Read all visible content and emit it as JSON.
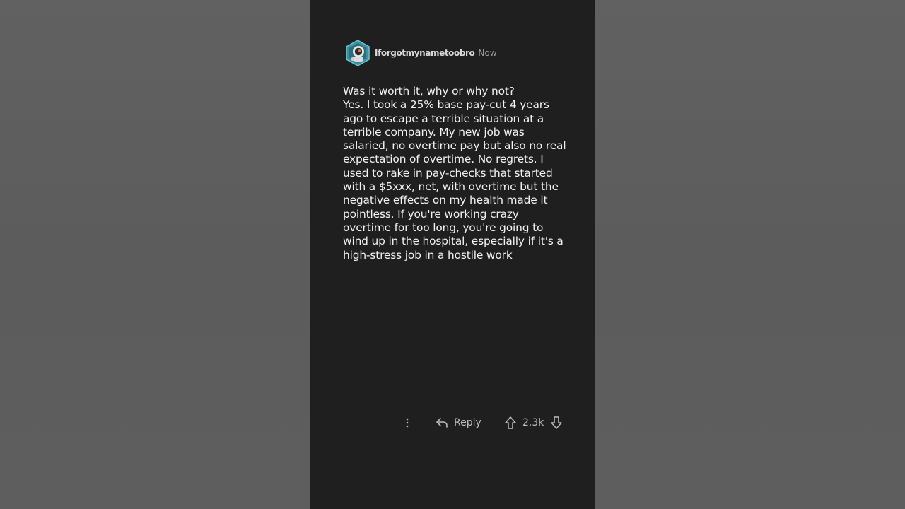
{
  "comment": {
    "username": "Iforgotmynametoobro",
    "timestamp": "Now",
    "body": "Was it worth it, why or why not?\nYes. I took a 25% base pay-cut 4 years ago to escape a terrible situation at a terrible company. My new job was salaried, no overtime pay but also no real expectation of overtime. No regrets. I used to rake in pay-checks that started with a $5xxx, net, with overtime but the negative effects on my health made it pointless. If you're working crazy overtime for too long, you're going to wind up in the hospital, especially if it's a high-stress job in a hostile work"
  },
  "actions": {
    "more_icon": "more-vertical-icon",
    "reply_icon": "reply-arrow-icon",
    "reply_label": "Reply",
    "upvote_icon": "upvote-arrow-icon",
    "vote_count": "2.3k",
    "downvote_icon": "downvote-arrow-icon"
  },
  "colors": {
    "background": "#5f5f5f",
    "card": "#1f1f1f",
    "text": "#f2f2f2",
    "muted": "#bdbdbd",
    "avatar_ring": "#4aa3b5"
  }
}
